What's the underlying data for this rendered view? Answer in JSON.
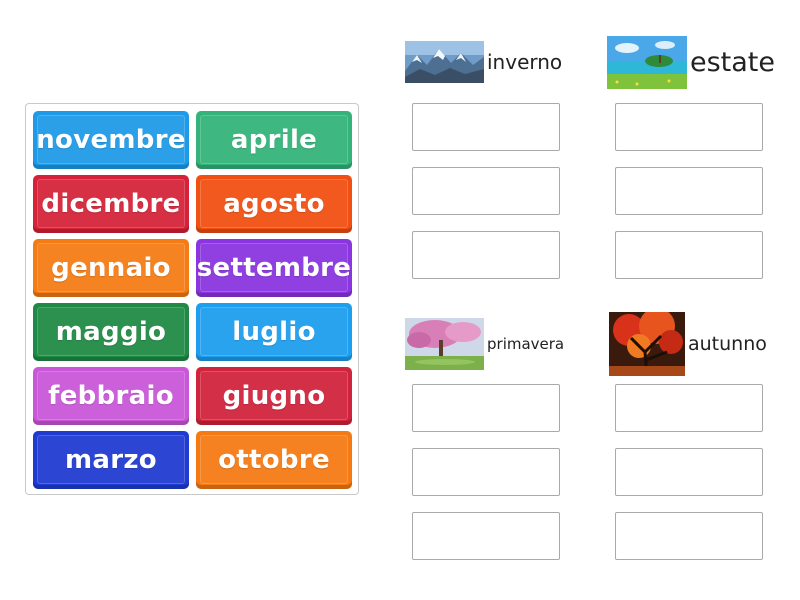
{
  "tiles": [
    {
      "label": "novembre",
      "color": "#1e9be8"
    },
    {
      "label": "aprile",
      "color": "#34b37a"
    },
    {
      "label": "dicembre",
      "color": "#d52238"
    },
    {
      "label": "agosto",
      "color": "#f24f12"
    },
    {
      "label": "gennaio",
      "color": "#f57c14"
    },
    {
      "label": "settembre",
      "color": "#8a35e0"
    },
    {
      "label": "maggio",
      "color": "#1f8a45"
    },
    {
      "label": "luglio",
      "color": "#1d9eef"
    },
    {
      "label": "febbraio",
      "color": "#c957d8"
    },
    {
      "label": "giugno",
      "color": "#d1233c"
    },
    {
      "label": "marzo",
      "color": "#1f3bd1"
    },
    {
      "label": "ottobre",
      "color": "#f57a14"
    }
  ],
  "groups": [
    {
      "label": "inverno",
      "image": "winter-mountains"
    },
    {
      "label": "estate",
      "image": "summer-lake"
    },
    {
      "label": "primavera",
      "image": "spring-blossom-tree"
    },
    {
      "label": "autunno",
      "image": "autumn-red-tree"
    }
  ]
}
